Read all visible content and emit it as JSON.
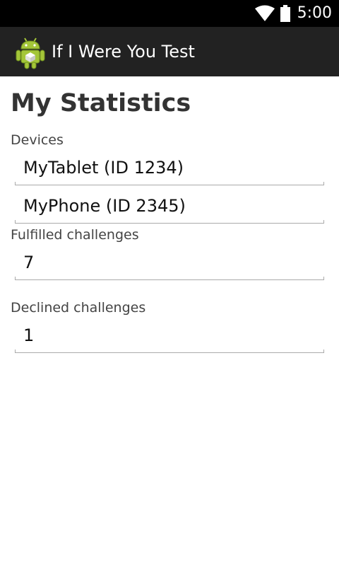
{
  "status_bar": {
    "time": "5:00",
    "icons": [
      "wifi-icon",
      "battery-icon"
    ]
  },
  "action_bar": {
    "app_icon": "android-icon",
    "title": "If I Were You Test",
    "colors": {
      "background": "#222222",
      "icon_green": "#8bc34a"
    }
  },
  "statistics": {
    "title": "My Statistics",
    "devices_label": "Devices",
    "devices": [
      "MyTablet (ID 1234)",
      "MyPhone (ID 2345)"
    ],
    "fulfilled_label": "Fulfilled challenges",
    "fulfilled_value": "7",
    "declined_label": "Declined challenges",
    "declined_value": "1"
  }
}
